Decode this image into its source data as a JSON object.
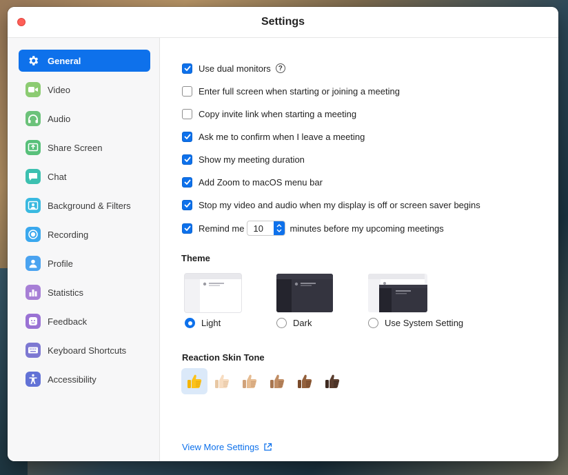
{
  "window": {
    "title": "Settings"
  },
  "sidebar": {
    "items": [
      {
        "label": "General",
        "icon": "gear-icon",
        "color": "#0e71eb",
        "active": true
      },
      {
        "label": "Video",
        "icon": "video-camera-icon",
        "color": "#7cc576"
      },
      {
        "label": "Audio",
        "icon": "headphones-icon",
        "color": "#6cc27a"
      },
      {
        "label": "Share Screen",
        "icon": "share-screen-icon",
        "color": "#58c07a"
      },
      {
        "label": "Chat",
        "icon": "chat-bubble-icon",
        "color": "#3cc0b0"
      },
      {
        "label": "Background & Filters",
        "icon": "person-background-icon",
        "color": "#39b9e0"
      },
      {
        "label": "Recording",
        "icon": "record-icon",
        "color": "#3aa8ee"
      },
      {
        "label": "Profile",
        "icon": "person-icon",
        "color": "#4aa3f0"
      },
      {
        "label": "Statistics",
        "icon": "bar-chart-icon",
        "color": "#a77fd6"
      },
      {
        "label": "Feedback",
        "icon": "smiley-icon",
        "color": "#9a72d4"
      },
      {
        "label": "Keyboard Shortcuts",
        "icon": "keyboard-icon",
        "color": "#7d78d2"
      },
      {
        "label": "Accessibility",
        "icon": "accessibility-icon",
        "color": "#6272d6"
      }
    ]
  },
  "general": {
    "options": [
      {
        "label": "Use dual monitors",
        "checked": true,
        "help": "?"
      },
      {
        "label": "Enter full screen when starting or joining a meeting",
        "checked": false
      },
      {
        "label": "Copy invite link when starting a meeting",
        "checked": false
      },
      {
        "label": "Ask me to confirm when I leave a meeting",
        "checked": true
      },
      {
        "label": "Show my meeting duration",
        "checked": true
      },
      {
        "label": "Add Zoom to macOS menu bar",
        "checked": true
      },
      {
        "label": "Stop my video and audio when my display is off or screen saver begins",
        "checked": true
      }
    ],
    "remind": {
      "checked": true,
      "prefix": "Remind me",
      "value": "10",
      "suffix": "minutes before my upcoming meetings"
    },
    "theme": {
      "title": "Theme",
      "options": [
        {
          "label": "Light",
          "selected": true
        },
        {
          "label": "Dark",
          "selected": false
        },
        {
          "label": "Use System Setting",
          "selected": false
        }
      ]
    },
    "skin_tone": {
      "title": "Reaction Skin Tone",
      "tones": [
        {
          "emoji": "👍",
          "selected": true
        },
        {
          "emoji": "👍🏻",
          "selected": false
        },
        {
          "emoji": "👍🏼",
          "selected": false
        },
        {
          "emoji": "👍🏽",
          "selected": false
        },
        {
          "emoji": "👍🏾",
          "selected": false
        },
        {
          "emoji": "👍🏿",
          "selected": false
        }
      ]
    },
    "view_more": "View More Settings"
  },
  "colors": {
    "accent": "#0e71eb",
    "close": "#fe5f57"
  }
}
